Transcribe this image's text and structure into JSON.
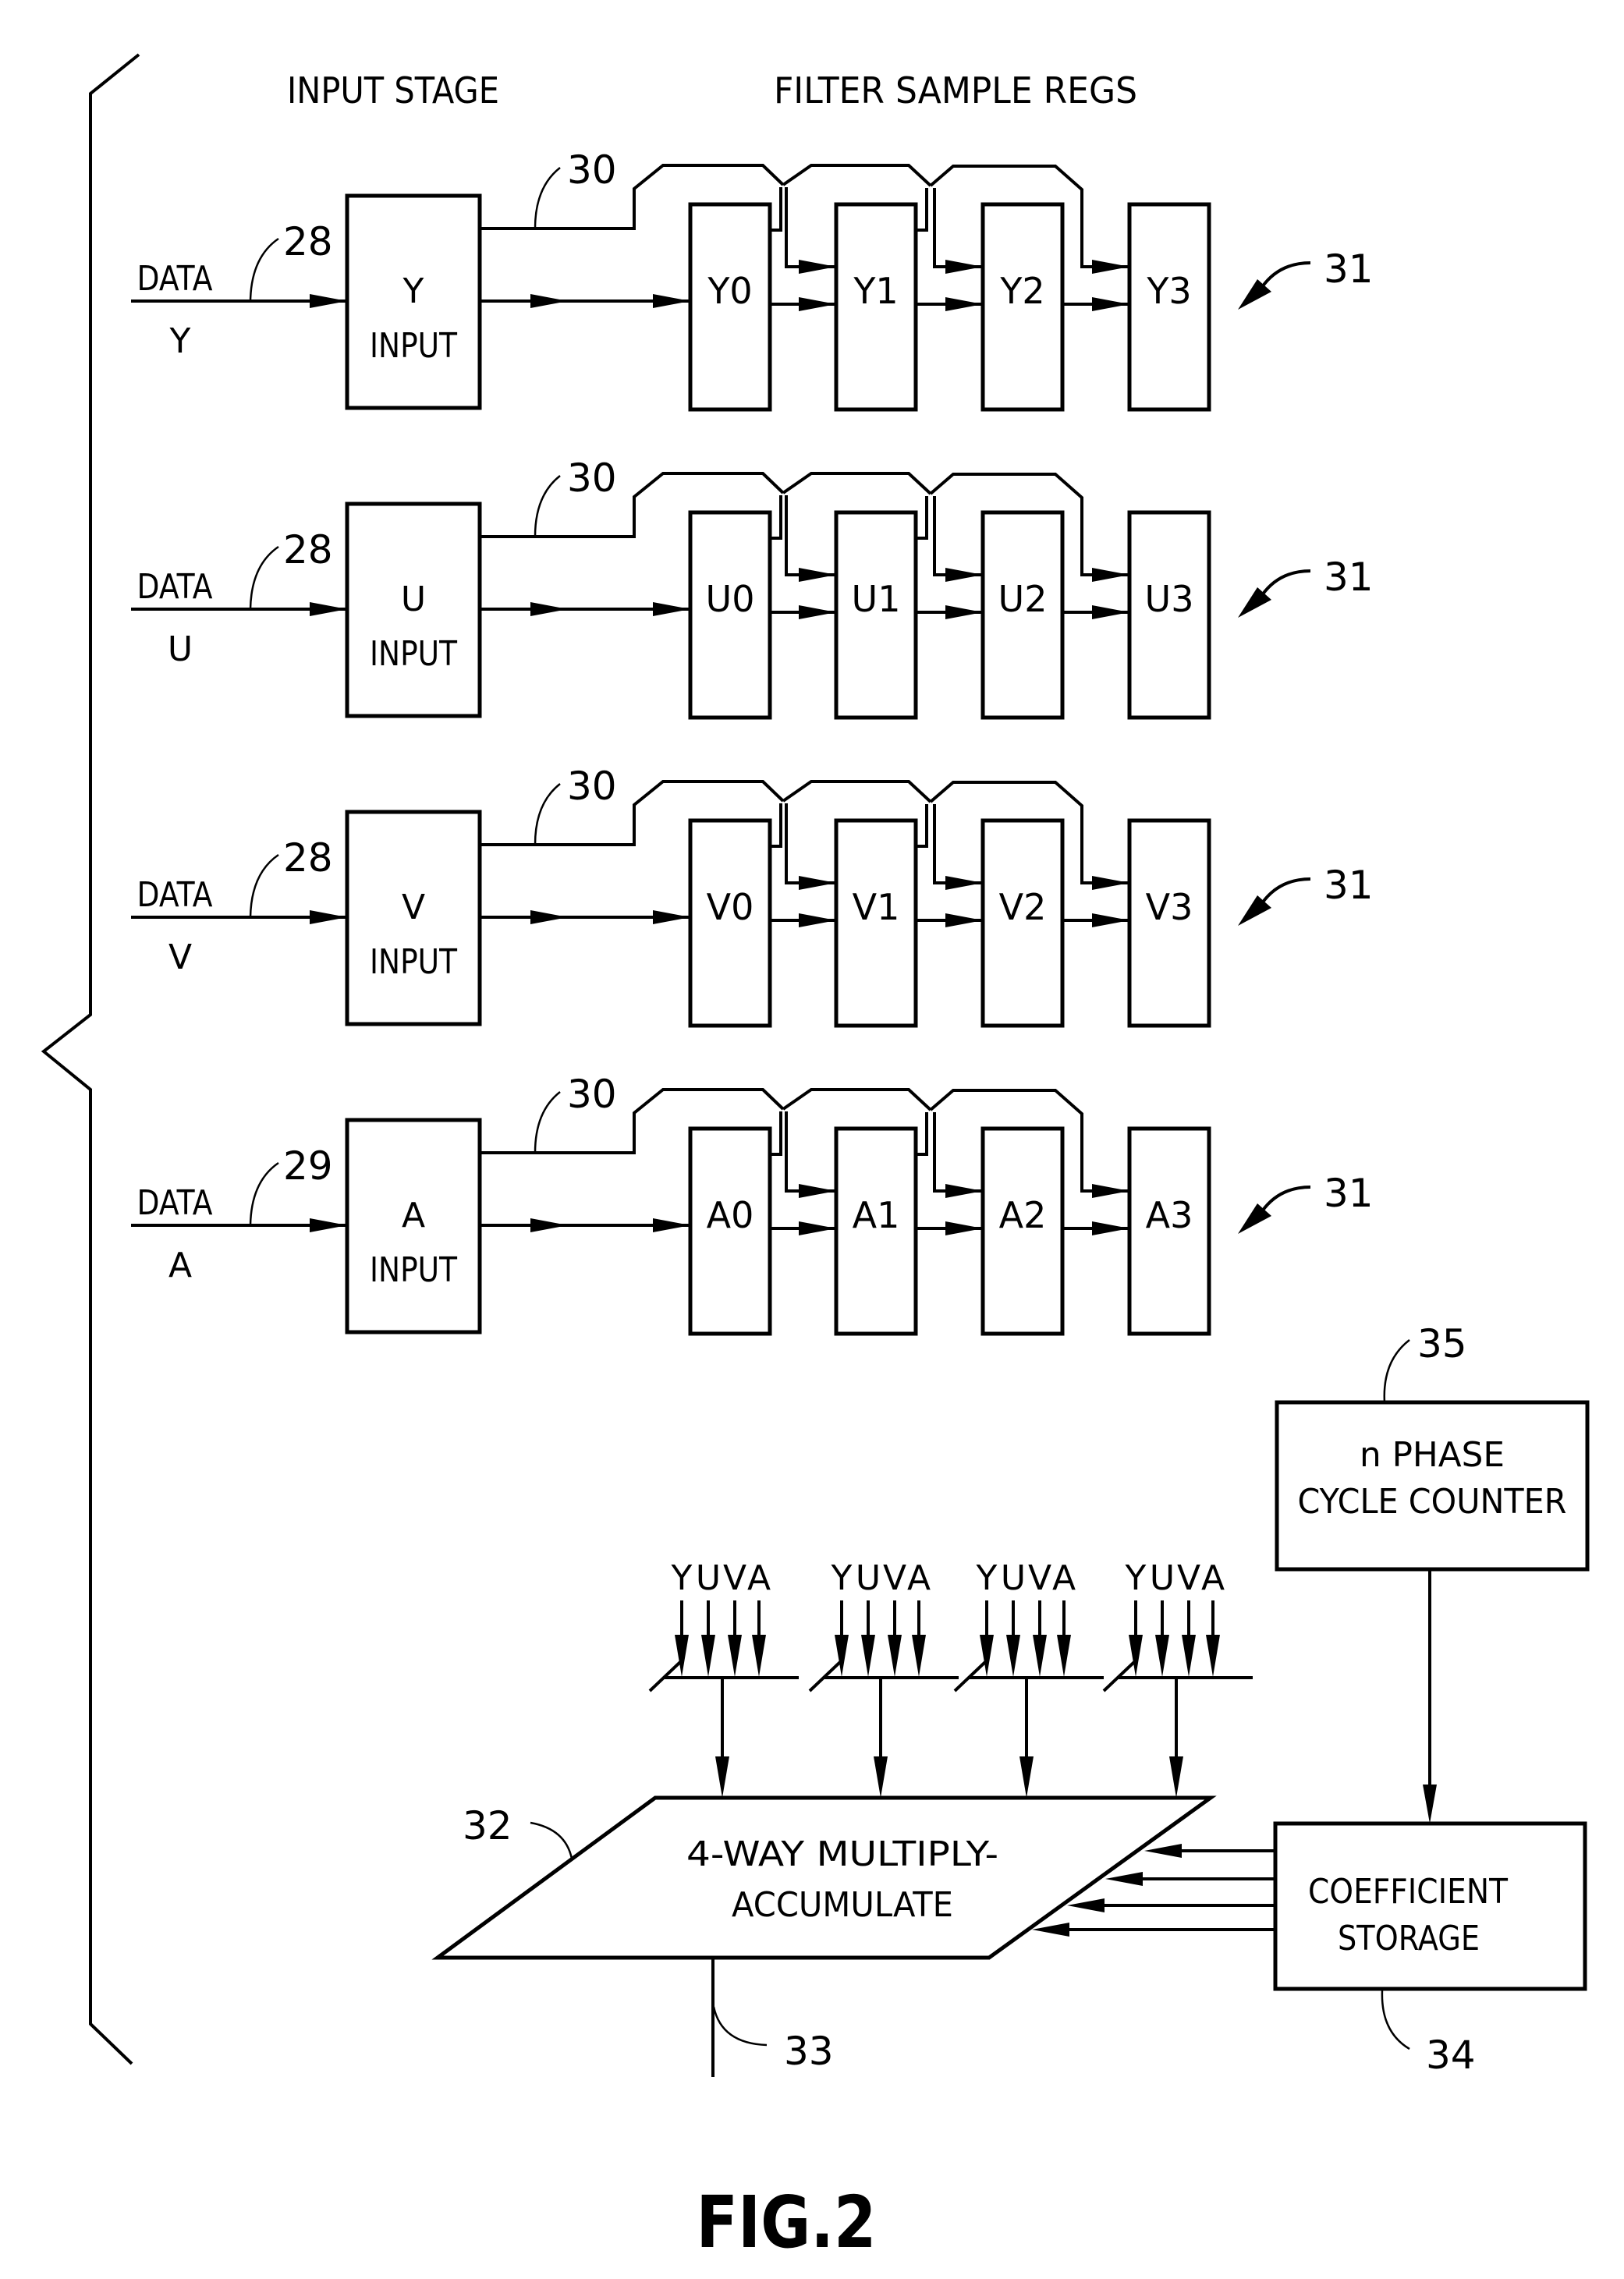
{
  "figure": {
    "caption": "FIG.2",
    "headers": {
      "input_stage": "INPUT STAGE",
      "filter_sample_regs": "FILTER SAMPLE REGS"
    },
    "channels": [
      {
        "key": "Y",
        "data_label": "DATA",
        "data_channel": "Y",
        "input_ref": "28",
        "input_box_line1": "Y",
        "input_box_line2": "INPUT",
        "bus_ref": "30",
        "registers": [
          "Y0",
          "Y1",
          "Y2",
          "Y3"
        ],
        "regs_ref": "31"
      },
      {
        "key": "U",
        "data_label": "DATA",
        "data_channel": "U",
        "input_ref": "28",
        "input_box_line1": "U",
        "input_box_line2": "INPUT",
        "bus_ref": "30",
        "registers": [
          "U0",
          "U1",
          "U2",
          "U3"
        ],
        "regs_ref": "31"
      },
      {
        "key": "V",
        "data_label": "DATA",
        "data_channel": "V",
        "input_ref": "28",
        "input_box_line1": "V",
        "input_box_line2": "INPUT",
        "bus_ref": "30",
        "registers": [
          "V0",
          "V1",
          "V2",
          "V3"
        ],
        "regs_ref": "31"
      },
      {
        "key": "A",
        "data_label": "DATA",
        "data_channel": "A",
        "input_ref": "29",
        "input_box_line1": "A",
        "input_box_line2": "INPUT",
        "bus_ref": "30",
        "registers": [
          "A0",
          "A1",
          "A2",
          "A3"
        ],
        "regs_ref": "31"
      }
    ],
    "mac": {
      "line1": "4-WAY MULTIPLY-",
      "line2": "ACCUMULATE",
      "ref": "32",
      "output_ref": "33",
      "input_groups": [
        [
          "Y",
          "U",
          "V",
          "A"
        ],
        [
          "Y",
          "U",
          "V",
          "A"
        ],
        [
          "Y",
          "U",
          "V",
          "A"
        ],
        [
          "Y",
          "U",
          "V",
          "A"
        ]
      ],
      "coefficient_lines": 4
    },
    "cycle_counter": {
      "line1": "n PHASE",
      "line2": "CYCLE COUNTER",
      "ref": "35"
    },
    "coefficient_storage": {
      "line1": "COEFFICIENT",
      "line2": "STORAGE",
      "ref": "34"
    }
  }
}
